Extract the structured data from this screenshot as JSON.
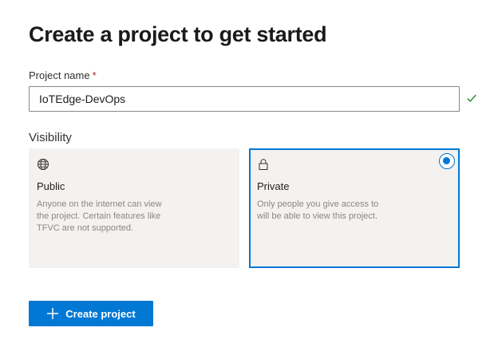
{
  "page": {
    "title": "Create a project to get started"
  },
  "project_name": {
    "label": "Project name",
    "required_marker": "*",
    "value": "IoTEdge-DevOps",
    "valid_icon": "check-icon"
  },
  "visibility": {
    "label": "Visibility",
    "selected": "private",
    "options": [
      {
        "id": "public",
        "icon": "globe-icon",
        "title": "Public",
        "description": "Anyone on the internet can view the project. Certain features like TFVC are not supported."
      },
      {
        "id": "private",
        "icon": "lock-icon",
        "title": "Private",
        "description": "Only people you give access to will be able to view this project."
      }
    ]
  },
  "actions": {
    "create_label": "Create project",
    "create_icon": "plus-icon"
  },
  "colors": {
    "accent": "#0078d4",
    "valid": "#107c10",
    "required": "#a4262c",
    "card_bg": "#f3f2f1"
  }
}
